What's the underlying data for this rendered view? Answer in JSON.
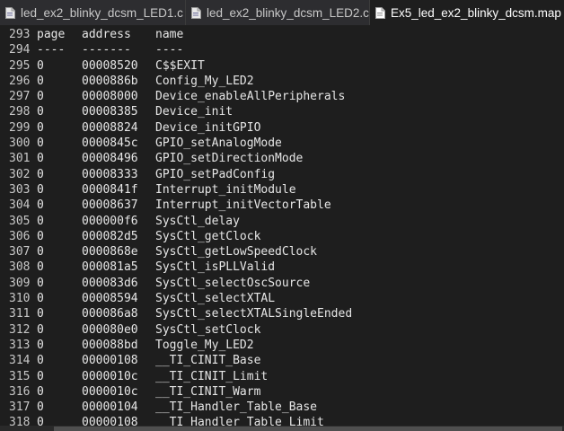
{
  "tabs": [
    {
      "label": "led_ex2_blinky_dcsm_LED1.c",
      "active": false,
      "icon": "c-file-icon"
    },
    {
      "label": "led_ex2_blinky_dcsm_LED2.c",
      "active": false,
      "icon": "c-file-icon"
    },
    {
      "label": "Ex5_led_ex2_blinky_dcsm.map",
      "active": true,
      "icon": "map-file-icon"
    }
  ],
  "editor": {
    "lines": [
      {
        "num": "293",
        "page": "page",
        "address": "address",
        "name": "name"
      },
      {
        "num": "294",
        "page": "----",
        "address": "-------",
        "name": "----"
      },
      {
        "num": "295",
        "page": "0",
        "address": "00008520",
        "name": "C$$EXIT"
      },
      {
        "num": "296",
        "page": "0",
        "address": "0000886b",
        "name": "Config_My_LED2"
      },
      {
        "num": "297",
        "page": "0",
        "address": "00008000",
        "name": "Device_enableAllPeripherals"
      },
      {
        "num": "298",
        "page": "0",
        "address": "00008385",
        "name": "Device_init"
      },
      {
        "num": "299",
        "page": "0",
        "address": "00008824",
        "name": "Device_initGPIO"
      },
      {
        "num": "300",
        "page": "0",
        "address": "0000845c",
        "name": "GPIO_setAnalogMode"
      },
      {
        "num": "301",
        "page": "0",
        "address": "00008496",
        "name": "GPIO_setDirectionMode"
      },
      {
        "num": "302",
        "page": "0",
        "address": "00008333",
        "name": "GPIO_setPadConfig"
      },
      {
        "num": "303",
        "page": "0",
        "address": "0000841f",
        "name": "Interrupt_initModule"
      },
      {
        "num": "304",
        "page": "0",
        "address": "00008637",
        "name": "Interrupt_initVectorTable"
      },
      {
        "num": "305",
        "page": "0",
        "address": "000000f6",
        "name": "SysCtl_delay"
      },
      {
        "num": "306",
        "page": "0",
        "address": "000082d5",
        "name": "SysCtl_getClock"
      },
      {
        "num": "307",
        "page": "0",
        "address": "0000868e",
        "name": "SysCtl_getLowSpeedClock"
      },
      {
        "num": "308",
        "page": "0",
        "address": "000081a5",
        "name": "SysCtl_isPLLValid"
      },
      {
        "num": "309",
        "page": "0",
        "address": "000083d6",
        "name": "SysCtl_selectOscSource"
      },
      {
        "num": "310",
        "page": "0",
        "address": "00008594",
        "name": "SysCtl_selectXTAL"
      },
      {
        "num": "311",
        "page": "0",
        "address": "000086a8",
        "name": "SysCtl_selectXTALSingleEnded"
      },
      {
        "num": "312",
        "page": "0",
        "address": "000080e0",
        "name": "SysCtl_setClock"
      },
      {
        "num": "313",
        "page": "0",
        "address": "000088bd",
        "name": "Toggle_My_LED2"
      },
      {
        "num": "314",
        "page": "0",
        "address": "00000108",
        "name": "__TI_CINIT_Base"
      },
      {
        "num": "315",
        "page": "0",
        "address": "0000010c",
        "name": "__TI_CINIT_Limit"
      },
      {
        "num": "316",
        "page": "0",
        "address": "0000010c",
        "name": "__TI_CINIT_Warm"
      },
      {
        "num": "317",
        "page": "0",
        "address": "00000104",
        "name": "__TI_Handler_Table_Base"
      },
      {
        "num": "318",
        "page": "0",
        "address": "00000108",
        "name": "__TI_Handler_Table_Limit"
      }
    ]
  },
  "colors": {
    "background": "#1e1e1e",
    "tabbar": "#2d2d30",
    "text": "#e6e6e6"
  }
}
